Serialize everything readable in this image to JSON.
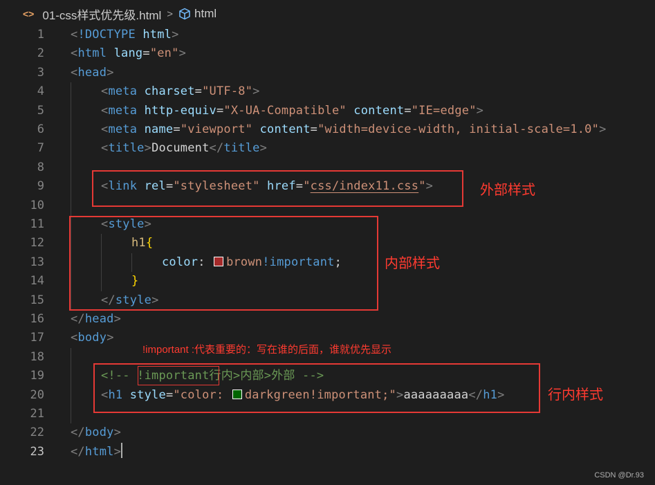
{
  "breadcrumb": {
    "file_icon": "<>",
    "file": "01-css样式优先级.html",
    "separator": ">",
    "element": "html"
  },
  "lines": [
    {
      "n": "1",
      "indent": 0,
      "tokens": [
        [
          "t-punc",
          "<"
        ],
        [
          "t-tag",
          "!DOCTYPE"
        ],
        [
          "t-text",
          " "
        ],
        [
          "t-attr",
          "html"
        ],
        [
          "t-punc",
          ">"
        ]
      ]
    },
    {
      "n": "2",
      "indent": 0,
      "tokens": [
        [
          "t-punc",
          "<"
        ],
        [
          "t-tag",
          "html"
        ],
        [
          "t-text",
          " "
        ],
        [
          "t-attr",
          "lang"
        ],
        [
          "t-text",
          "="
        ],
        [
          "t-str",
          "\"en\""
        ],
        [
          "t-punc",
          ">"
        ]
      ]
    },
    {
      "n": "3",
      "indent": 0,
      "tokens": [
        [
          "t-punc",
          "<"
        ],
        [
          "t-tag",
          "head"
        ],
        [
          "t-punc",
          ">"
        ]
      ]
    },
    {
      "n": "4",
      "indent": 1,
      "tokens": [
        [
          "t-punc",
          "<"
        ],
        [
          "t-tag",
          "meta"
        ],
        [
          "t-text",
          " "
        ],
        [
          "t-attr",
          "charset"
        ],
        [
          "t-text",
          "="
        ],
        [
          "t-str",
          "\"UTF-8\""
        ],
        [
          "t-punc",
          ">"
        ]
      ]
    },
    {
      "n": "5",
      "indent": 1,
      "tokens": [
        [
          "t-punc",
          "<"
        ],
        [
          "t-tag",
          "meta"
        ],
        [
          "t-text",
          " "
        ],
        [
          "t-attr",
          "http-equiv"
        ],
        [
          "t-text",
          "="
        ],
        [
          "t-str",
          "\"X-UA-Compatible\""
        ],
        [
          "t-text",
          " "
        ],
        [
          "t-attr",
          "content"
        ],
        [
          "t-text",
          "="
        ],
        [
          "t-str",
          "\"IE=edge\""
        ],
        [
          "t-punc",
          ">"
        ]
      ]
    },
    {
      "n": "6",
      "indent": 1,
      "tokens": [
        [
          "t-punc",
          "<"
        ],
        [
          "t-tag",
          "meta"
        ],
        [
          "t-text",
          " "
        ],
        [
          "t-attr",
          "name"
        ],
        [
          "t-text",
          "="
        ],
        [
          "t-str",
          "\"viewport\""
        ],
        [
          "t-text",
          " "
        ],
        [
          "t-attr",
          "content"
        ],
        [
          "t-text",
          "="
        ],
        [
          "t-str",
          "\"width=device-width, initial-scale=1.0\""
        ],
        [
          "t-punc",
          ">"
        ]
      ]
    },
    {
      "n": "7",
      "indent": 1,
      "tokens": [
        [
          "t-punc",
          "<"
        ],
        [
          "t-tag",
          "title"
        ],
        [
          "t-punc",
          ">"
        ],
        [
          "t-text",
          "Document"
        ],
        [
          "t-punc",
          "</"
        ],
        [
          "t-tag",
          "title"
        ],
        [
          "t-punc",
          ">"
        ]
      ]
    },
    {
      "n": "8",
      "indent": 1,
      "tokens": []
    },
    {
      "n": "9",
      "indent": 1,
      "tokens": [
        [
          "t-punc",
          "<"
        ],
        [
          "t-tag",
          "link"
        ],
        [
          "t-text",
          " "
        ],
        [
          "t-attr",
          "rel"
        ],
        [
          "t-text",
          "="
        ],
        [
          "t-str",
          "\"stylesheet\""
        ],
        [
          "t-text",
          " "
        ],
        [
          "t-attr",
          "href"
        ],
        [
          "t-text",
          "="
        ],
        [
          "t-str",
          "\""
        ],
        [
          "t-str t-underline",
          "css/index11.css"
        ],
        [
          "t-str",
          "\""
        ],
        [
          "t-punc",
          ">"
        ]
      ]
    },
    {
      "n": "10",
      "indent": 1,
      "tokens": []
    },
    {
      "n": "11",
      "indent": 1,
      "tokens": [
        [
          "t-punc",
          "<"
        ],
        [
          "t-tag",
          "style"
        ],
        [
          "t-punc",
          ">"
        ]
      ]
    },
    {
      "n": "12",
      "indent": 2,
      "tokens": [
        [
          "t-sel",
          "h1"
        ],
        [
          "t-brace",
          "{"
        ]
      ]
    },
    {
      "n": "13",
      "indent": 3,
      "tokens": [
        [
          "t-prop",
          "color"
        ],
        [
          "t-text",
          ": "
        ],
        [
          "swatch",
          "#a52a2a"
        ],
        [
          "t-val",
          "brown"
        ],
        [
          "t-imp",
          "!important"
        ],
        [
          "t-text",
          ";"
        ]
      ]
    },
    {
      "n": "14",
      "indent": 2,
      "tokens": [
        [
          "t-brace",
          "}"
        ]
      ]
    },
    {
      "n": "15",
      "indent": 1,
      "tokens": [
        [
          "t-punc",
          "</"
        ],
        [
          "t-tag",
          "style"
        ],
        [
          "t-punc",
          ">"
        ]
      ]
    },
    {
      "n": "16",
      "indent": 0,
      "tokens": [
        [
          "t-punc",
          "</"
        ],
        [
          "t-tag",
          "head"
        ],
        [
          "t-punc",
          ">"
        ]
      ]
    },
    {
      "n": "17",
      "indent": 0,
      "tokens": [
        [
          "t-punc",
          "<"
        ],
        [
          "t-tag",
          "body"
        ],
        [
          "t-punc",
          ">"
        ]
      ]
    },
    {
      "n": "18",
      "indent": 1,
      "tokens": []
    },
    {
      "n": "19",
      "indent": 1,
      "tokens": [
        [
          "t-comment",
          "<!-- !important行内>内部>外部 -->"
        ]
      ]
    },
    {
      "n": "20",
      "indent": 1,
      "tokens": [
        [
          "t-punc",
          "<"
        ],
        [
          "t-tag",
          "h1"
        ],
        [
          "t-text",
          " "
        ],
        [
          "t-attr",
          "style"
        ],
        [
          "t-text",
          "="
        ],
        [
          "t-str",
          "\"color: "
        ],
        [
          "swatch",
          "#006400"
        ],
        [
          "t-str",
          "darkgreen!important;\""
        ],
        [
          "t-punc",
          ">"
        ],
        [
          "t-text",
          "aaaaaaaaa"
        ],
        [
          "t-punc",
          "</"
        ],
        [
          "t-tag",
          "h1"
        ],
        [
          "t-punc",
          ">"
        ]
      ]
    },
    {
      "n": "21",
      "indent": 1,
      "tokens": []
    },
    {
      "n": "22",
      "indent": 0,
      "tokens": [
        [
          "t-punc",
          "</"
        ],
        [
          "t-tag",
          "body"
        ],
        [
          "t-punc",
          ">"
        ]
      ]
    },
    {
      "n": "23",
      "indent": 0,
      "tokens": [
        [
          "t-punc",
          "</"
        ],
        [
          "t-tag",
          "html"
        ],
        [
          "t-punc",
          ">"
        ],
        [
          "cursor",
          ""
        ]
      ]
    }
  ],
  "current_line": "23",
  "annotations": {
    "external": "外部样式",
    "internal": "内部样式",
    "inline": "行内样式",
    "note": "!important :代表重要的：写在谁的后面，谁就优先显示"
  },
  "watermark": "CSDN @Dr.93",
  "colors": {
    "background": "#1e1e1e",
    "annotation_red": "#e53935",
    "tag": "#569cd6",
    "attribute": "#9cdcfe",
    "string": "#ce9178",
    "comment": "#6a9955"
  }
}
